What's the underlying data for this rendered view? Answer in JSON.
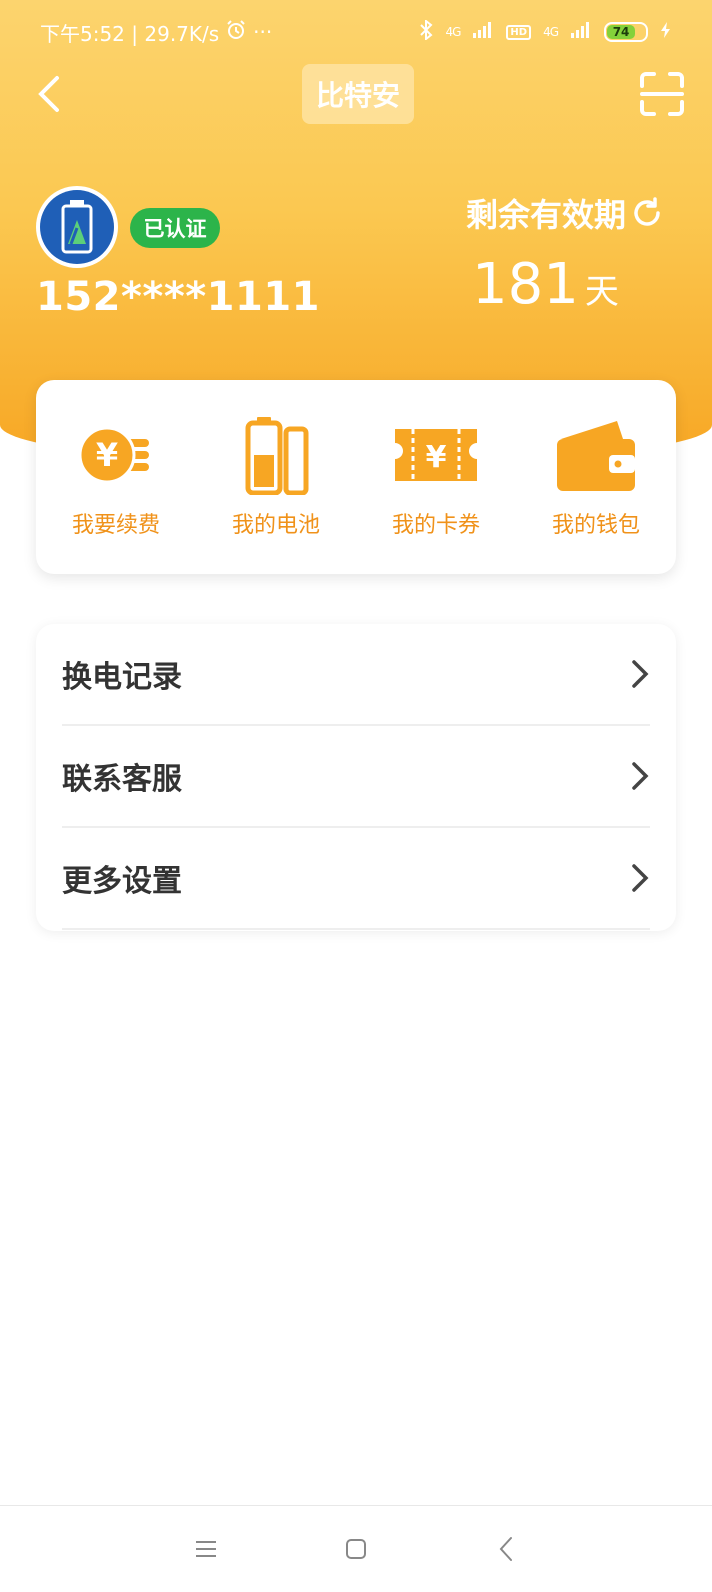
{
  "status_bar": {
    "time_speed": "下午5:52 | 29.7K/s",
    "more": "···",
    "signal1": "4G",
    "hd": "HD",
    "signal2": "4G",
    "battery_level": "74"
  },
  "nav": {
    "title": "比特安"
  },
  "profile": {
    "verified_label": "已认证",
    "phone": "152****1111",
    "validity_label": "剩余有效期",
    "validity_days": "181",
    "validity_unit": "天"
  },
  "quick_actions": [
    {
      "label": "我要续费",
      "icon": "renew-yuan-icon"
    },
    {
      "label": "我的电池",
      "icon": "battery-icon"
    },
    {
      "label": "我的卡券",
      "icon": "coupon-icon"
    },
    {
      "label": "我的钱包",
      "icon": "wallet-icon"
    }
  ],
  "menu": [
    {
      "label": "换电记录"
    },
    {
      "label": "联系客服"
    },
    {
      "label": "更多设置"
    }
  ],
  "colors": {
    "accent": "#f7a623",
    "verified": "#2cb44a",
    "action_label": "#f0921a"
  }
}
